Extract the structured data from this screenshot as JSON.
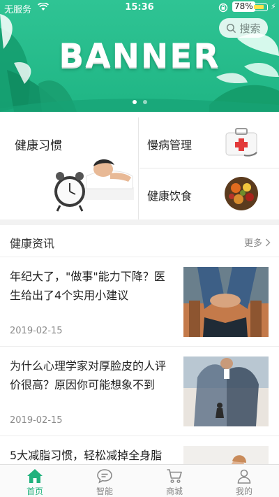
{
  "status_bar": {
    "carrier": "无服务",
    "time": "15:36",
    "battery": "78%"
  },
  "banner": {
    "title": "BANNER",
    "search_label": "搜索",
    "pages": 2,
    "active_page": 1
  },
  "categories": {
    "main": {
      "label": "健康习惯"
    },
    "items": [
      {
        "label": "慢病管理"
      },
      {
        "label": "健康饮食"
      }
    ]
  },
  "news": {
    "section_title": "健康资讯",
    "more_label": "更多",
    "items": [
      {
        "title": "年纪大了，\"做事\"能力下降？医生给出了4个实用小建议",
        "date": "2019-02-15"
      },
      {
        "title": "为什么心理学家对厚脸皮的人评价很高？原因你可能想象不到",
        "date": "2019-02-15"
      },
      {
        "title": "5大减脂习惯，轻松减掉全身脂",
        "date": ""
      }
    ]
  },
  "tabbar": {
    "tabs": [
      {
        "label": "首页",
        "icon": "home-icon",
        "active": true
      },
      {
        "label": "智能",
        "icon": "chat-bubble-icon",
        "active": false
      },
      {
        "label": "商城",
        "icon": "cart-icon",
        "active": false
      },
      {
        "label": "我的",
        "icon": "user-icon",
        "active": false
      }
    ]
  },
  "colors": {
    "brand_green": "#21b27d",
    "banner_green": "#2fc494"
  }
}
